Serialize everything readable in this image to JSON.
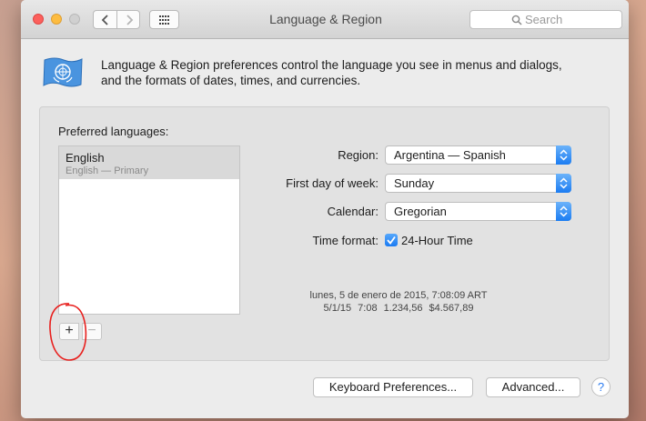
{
  "window": {
    "title": "Language & Region",
    "search": {
      "placeholder": "Search"
    }
  },
  "header": {
    "icon": "un-flag-icon",
    "description_line1": "Language & Region preferences control the language you see in menus and dialogs,",
    "description_line2": "and the formats of dates, times, and currencies."
  },
  "languages": {
    "label": "Preferred languages:",
    "items": [
      {
        "name": "English",
        "subtitle": "English — Primary"
      }
    ],
    "add_label": "+",
    "remove_label": "−"
  },
  "settings": {
    "region": {
      "label": "Region:",
      "value": "Argentina — Spanish"
    },
    "first_day": {
      "label": "First day of week:",
      "value": "Sunday"
    },
    "calendar": {
      "label": "Calendar:",
      "value": "Gregorian"
    },
    "time_format": {
      "label": "Time format:",
      "checkbox_label": "24-Hour Time",
      "checked": true
    }
  },
  "sample": {
    "date_line": "lunes, 5 de enero de 2015, 7:08:09 ART",
    "numbers_line": "5/1/15 7:08   1.234,56   $4.567,89"
  },
  "footer": {
    "keyboard_label": "Keyboard Preferences...",
    "advanced_label": "Advanced...",
    "help_label": "?"
  },
  "colors": {
    "accent": "#1b7cf2",
    "annotation": "#e8201e"
  }
}
